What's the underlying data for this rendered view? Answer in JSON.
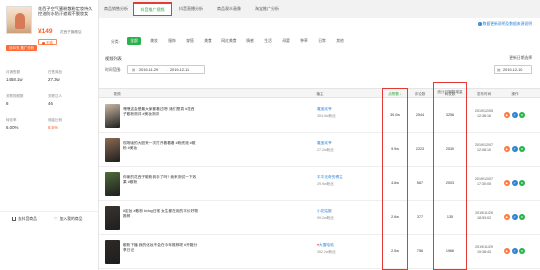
{
  "product": {
    "title": "花西子空气蜜粉散粉定妆持久控油防水防汗遮瑕不脱妆女",
    "price_symbol": "¥",
    "price": "149",
    "price_unit": "券后",
    "shop": "花西子旗舰店",
    "tag": "天猫",
    "badge": "近30天 推广分析"
  },
  "stats": [
    {
      "label": "月销售额",
      "value": "1458.1w",
      "warn": false
    },
    {
      "label": "在售商品",
      "value": "27.3w",
      "warn": false
    },
    {
      "label": "关联视频数",
      "value": "8",
      "warn": false
    },
    {
      "label": "关联达人",
      "value": "46",
      "warn": false
    },
    {
      "label": "转化率",
      "value": "6.00%",
      "warn": false
    },
    {
      "label": "佣金比例",
      "value": "8.5%",
      "warn": true
    }
  ],
  "left_buttons": {
    "add": "去抖音商品",
    "fav": "加入我的商品"
  },
  "tabs": [
    "商品销售分析",
    "抖音推广视频",
    "抖音直播分析",
    "商品观众画像",
    "淘宝推广分析"
  ],
  "tab_active": 1,
  "notice": "数据更新说明及数据来源说明",
  "categories": {
    "label": "分类:",
    "items": [
      "全部",
      "美妆",
      "服饰",
      "穿搭",
      "美食",
      "网红美食",
      "情感",
      "生活",
      "母婴",
      "种草",
      "日常",
      "其他"
    ],
    "active": 0
  },
  "section_title": "视频列表",
  "range": {
    "label": "时间范围:",
    "start": "2019-11-29",
    "end": "2019-12-11"
  },
  "right_filter": {
    "label": "更新日期选择",
    "value": "2019-12-10"
  },
  "table": {
    "headers": [
      "视频",
      "播主",
      "点赞数 ↓",
      "评论数",
      "转发数",
      "统计日期数增量",
      "发布时间",
      "操作"
    ],
    "rows": [
      {
        "desc": "嘿嘿这会是最大家都看过吧! 她们是真 #花西子散粉测评 #美妆测评",
        "author": "嘉宝欢爷",
        "fans": "304.9w粉丝",
        "likes": "30.0w",
        "comments": "2544",
        "shares": "",
        "increment": "3256",
        "pubtime": "2019/12/05 12:38:16",
        "thumb": "#c9b8a6"
      },
      {
        "desc": "现场版的大胆来一次打开看看看 #粉底液 #散粉 #美妆",
        "author": "嘉宝欢爷",
        "fans": "27.2w粉丝",
        "likes": "9.9w",
        "comments": "2223",
        "shares": "",
        "increment": "2530",
        "pubtime": "2019/12/07 12:08:10",
        "thumb": "#8c6b54"
      },
      {
        "desc": "你家的花西子散粉到手了吗? 我来测试一下效果 #散粉",
        "author": "平平无奇的博主",
        "fans": "29.9w粉丝",
        "likes": "4.6w",
        "comments": "567",
        "shares": "",
        "increment": "2003",
        "pubtime": "2019/12/07 17:30:05",
        "thumb": "#4f6b3a"
      },
      {
        "desc": "#定妆 #散粉 #vlog日常 女生都在用的平价好物推荐",
        "author": "小花姑娘",
        "fans": "99.2w粉丝",
        "likes": "2.6w",
        "comments": "377",
        "shares": "",
        "increment": "135",
        "pubtime": "2019/11/29 18:53:02",
        "thumb": "#3a3430"
      },
      {
        "desc": "散粉下播 我的化妆不会在今年推荐呢 #开箱分享日记",
        "author": "大富哈哈",
        "fans": "262.2w粉丝",
        "likes": "2.5w",
        "comments": "756",
        "shares": "",
        "increment": "1966",
        "pubtime": "2019/11/29 19:38:43",
        "thumb": "#2d2a28"
      }
    ]
  }
}
